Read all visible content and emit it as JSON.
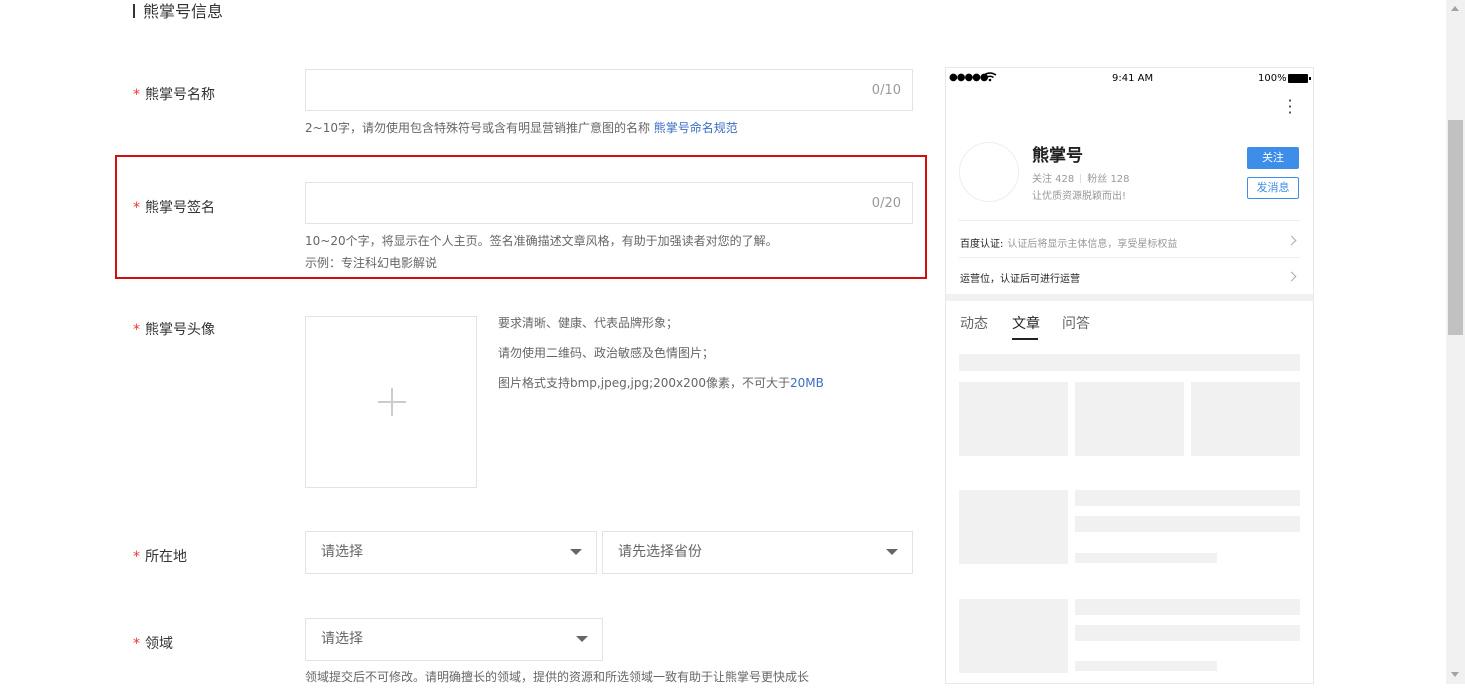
{
  "section_title": "熊掌号信息",
  "fields": {
    "name": {
      "label": "熊掌号名称",
      "counter": "0/10",
      "hint": "2~10字，请勿使用包含特殊符号或含有明显营销推广意图的名称",
      "hint_link": "熊掌号命名规范"
    },
    "signature": {
      "label": "熊掌号签名",
      "counter": "0/20",
      "hint": "10~20个字，将显示在个人主页。签名准确描述文章风格，有助于加强读者对您的了解。",
      "example": "示例：专注科幻电影解说"
    },
    "avatar": {
      "label": "熊掌号头像",
      "req1": "要求清晰、健康、代表品牌形象；",
      "req2": "请勿使用二维码、政治敏感及色情图片；",
      "req3_prefix": "图片格式支持bmp,jpeg,jpg;200x200像素，不可大于",
      "req3_link": "20MB"
    },
    "location": {
      "label": "所在地",
      "province_placeholder": "请选择",
      "city_placeholder": "请先选择省份"
    },
    "domain": {
      "label": "领域",
      "placeholder": "请选择",
      "hint": "领域提交后不可修改。请明确擅长的领域，提供的资源和所选领域一致有助于让熊掌号更快成长"
    }
  },
  "required_mark": "*",
  "preview": {
    "status_dots": "●●●●●",
    "status_time": "9:41 AM",
    "status_battery": "100%",
    "profile_name": "熊掌号",
    "follow_count": "关注 428",
    "fans_count": "粉丝 128",
    "motto": "让优质资源脱颖而出!",
    "follow_button": "关注",
    "message_button": "发消息",
    "baidu_cert_label": "百度认证:",
    "baidu_cert_desc": "认证后将显示主体信息，享受星标权益",
    "ops_label": "运营位，认证后可进行运营",
    "tabs": [
      "动态",
      "文章",
      "问答"
    ]
  }
}
